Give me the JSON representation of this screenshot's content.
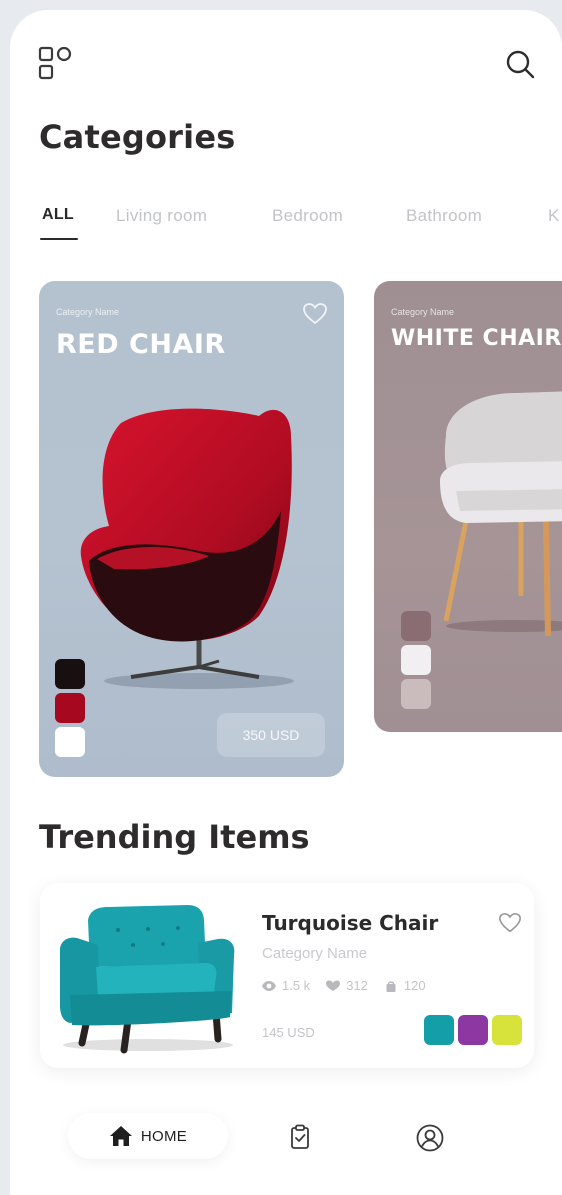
{
  "header": {
    "logo_icon": "app-logo-icon",
    "search_icon": "search-icon"
  },
  "page_title": "Categories",
  "tabs": [
    {
      "label": "ALL",
      "active": true
    },
    {
      "label": "Living room",
      "active": false
    },
    {
      "label": "Bedroom",
      "active": false
    },
    {
      "label": "Bathroom",
      "active": false
    },
    {
      "label": "K",
      "active": false
    }
  ],
  "cards": [
    {
      "caption": "Category Name",
      "title": "RED CHAIR",
      "price": "350 USD",
      "background": "#b4c1cf",
      "swatches": [
        "#170f10",
        "#a5081f",
        "#ffffff"
      ]
    },
    {
      "caption": "Category Name",
      "title": "WHITE CHAIR",
      "background": "#a39295",
      "swatches": [
        "#8a6d73",
        "#f2eff2",
        "#cabcbd"
      ]
    }
  ],
  "trending": {
    "title": "Trending Items",
    "item": {
      "name": "Turquoise Chair",
      "category": "Category Name",
      "views": "1.5 k",
      "likes": "312",
      "purchases": "120",
      "price": "145 USD",
      "swatches": [
        "#149ea8",
        "#8c37a2",
        "#d7e23b"
      ]
    }
  },
  "nav": {
    "home_label": "HOME"
  },
  "colors": {
    "text_primary": "#2e2b2c",
    "text_muted": "#c3c4c7"
  }
}
